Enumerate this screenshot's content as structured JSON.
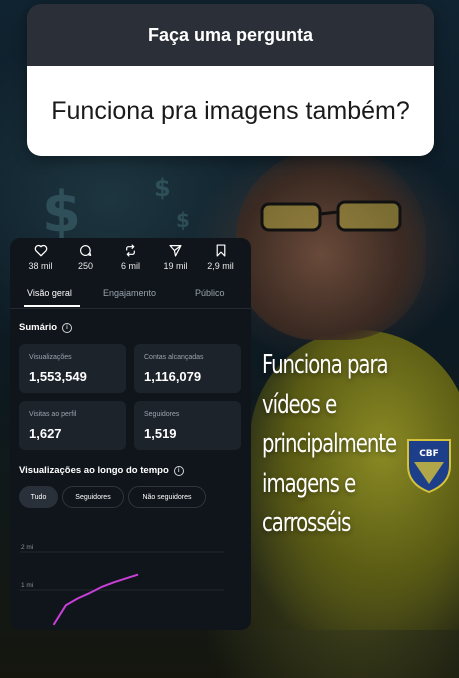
{
  "question_sticker": {
    "header": "Faça uma pergunta",
    "question": "Funciona pra imagens também?"
  },
  "insights": {
    "stats": [
      {
        "icon": "heart-icon",
        "value": "38 mil"
      },
      {
        "icon": "comment-icon",
        "value": "250"
      },
      {
        "icon": "repost-icon",
        "value": "6 mil"
      },
      {
        "icon": "share-icon",
        "value": "19 mil"
      },
      {
        "icon": "bookmark-icon",
        "value": "2,9 mil"
      }
    ],
    "tabs": [
      "Visão geral",
      "Engajamento",
      "Público"
    ],
    "active_tab": "Visão geral",
    "summary": {
      "title": "Sumário",
      "tiles": [
        {
          "label": "Visualizações",
          "value": "1,553,549"
        },
        {
          "label": "Contas alcançadas",
          "value": "1,116,079"
        },
        {
          "label": "Visitas ao perfil",
          "value": "1,627"
        },
        {
          "label": "Seguidores",
          "value": "1,519"
        }
      ]
    },
    "views_over_time": {
      "title": "Visualizações ao longo do tempo",
      "filters": [
        "Tudo",
        "Seguidores",
        "Não seguidores"
      ],
      "active_filter": "Tudo"
    }
  },
  "chart_data": {
    "type": "line",
    "title": "",
    "xlabel": "",
    "ylabel": "",
    "y_ticks": [
      "2 mi",
      "1 mi"
    ],
    "ylim": [
      0,
      2000000
    ],
    "x": [
      0,
      1,
      2,
      3,
      4,
      5,
      6,
      7
    ],
    "series": [
      {
        "values": [
          100000,
          600000,
          780000,
          920000,
          1080000,
          1200000,
          1300000,
          1400000
        ],
        "color": "#c83fd6"
      }
    ]
  },
  "caption": {
    "lines": [
      "Funciona para",
      "vídeos e",
      "principalmente",
      "imagens e",
      "carrosséis"
    ]
  },
  "colors": {
    "card_bg": "#10151b",
    "tile_bg": "#1d232b",
    "line": "#c83fd6",
    "shirt": "#8a8a24"
  }
}
